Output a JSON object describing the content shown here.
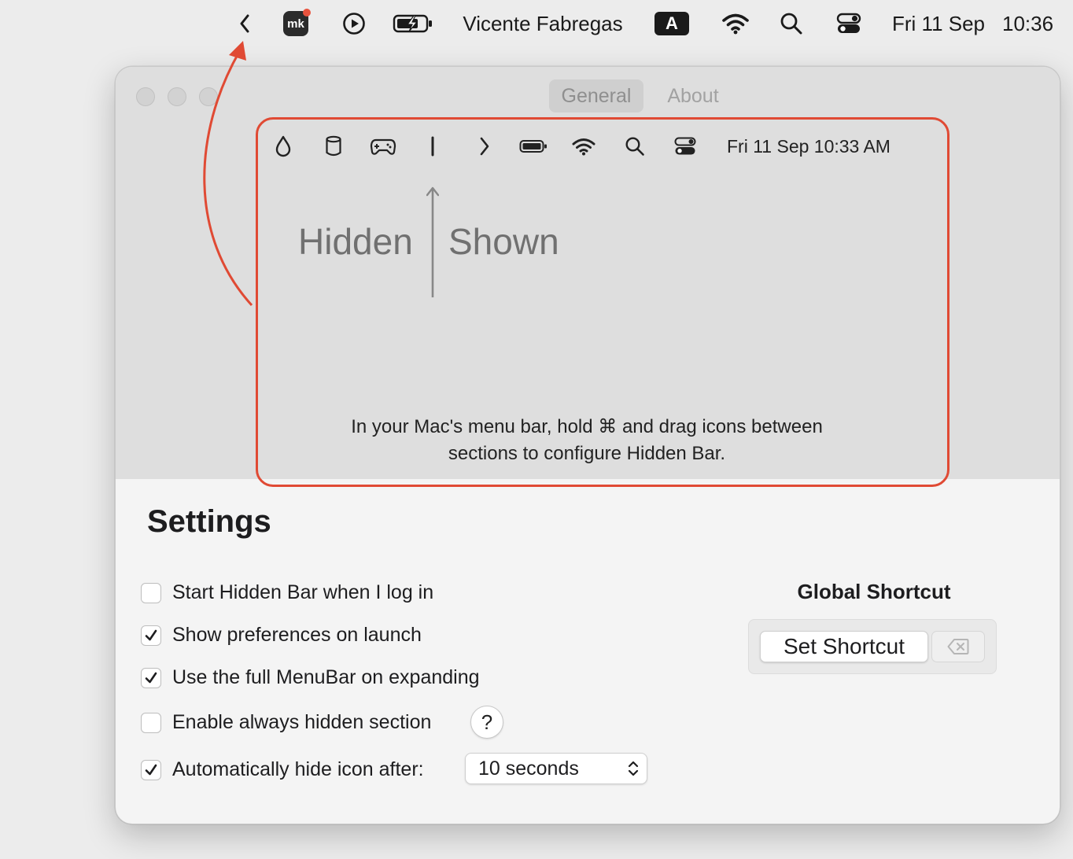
{
  "menubar": {
    "user_name": "Vicente Fabregas",
    "input_source": "A",
    "date": "Fri 11 Sep",
    "time": "10:36",
    "mk_text": "mk",
    "icons": [
      "chevron-left-icon",
      "mk-app-icon",
      "play-icon",
      "battery-charging-icon",
      "wifi-icon",
      "search-icon",
      "control-center-icon"
    ]
  },
  "window": {
    "tabs": [
      {
        "label": "General",
        "active": true
      },
      {
        "label": "About",
        "active": false
      }
    ],
    "preview": {
      "date_time": "Fri 11 Sep 10:33 AM",
      "hidden_label": "Hidden",
      "shown_label": "Shown",
      "instructions": "In your Mac's menu bar, hold ⌘ and drag icons between sections to configure Hidden Bar.",
      "icons": [
        "droplet-icon",
        "cylinder-icon",
        "gamepad-icon",
        "separator-icon",
        "chevron-right-icon",
        "battery-icon",
        "wifi-icon",
        "search-icon",
        "control-center-icon"
      ]
    },
    "settings": {
      "title": "Settings",
      "options": [
        {
          "label": "Start Hidden Bar when I log in",
          "checked": false
        },
        {
          "label": "Show preferences on launch",
          "checked": true
        },
        {
          "label": "Use the full MenuBar on expanding",
          "checked": true
        },
        {
          "label": "Enable always hidden section",
          "checked": false
        },
        {
          "label": "Automatically hide icon after:",
          "checked": true
        }
      ],
      "help_label": "?",
      "auto_hide_value": "10 seconds"
    },
    "global_shortcut": {
      "title": "Global Shortcut",
      "set_label": "Set Shortcut"
    }
  },
  "colors": {
    "annotation": "#e04a34",
    "menubar_text": "#1a1a1a",
    "window_top": "#dedede",
    "window_bottom": "#f4f4f4"
  }
}
